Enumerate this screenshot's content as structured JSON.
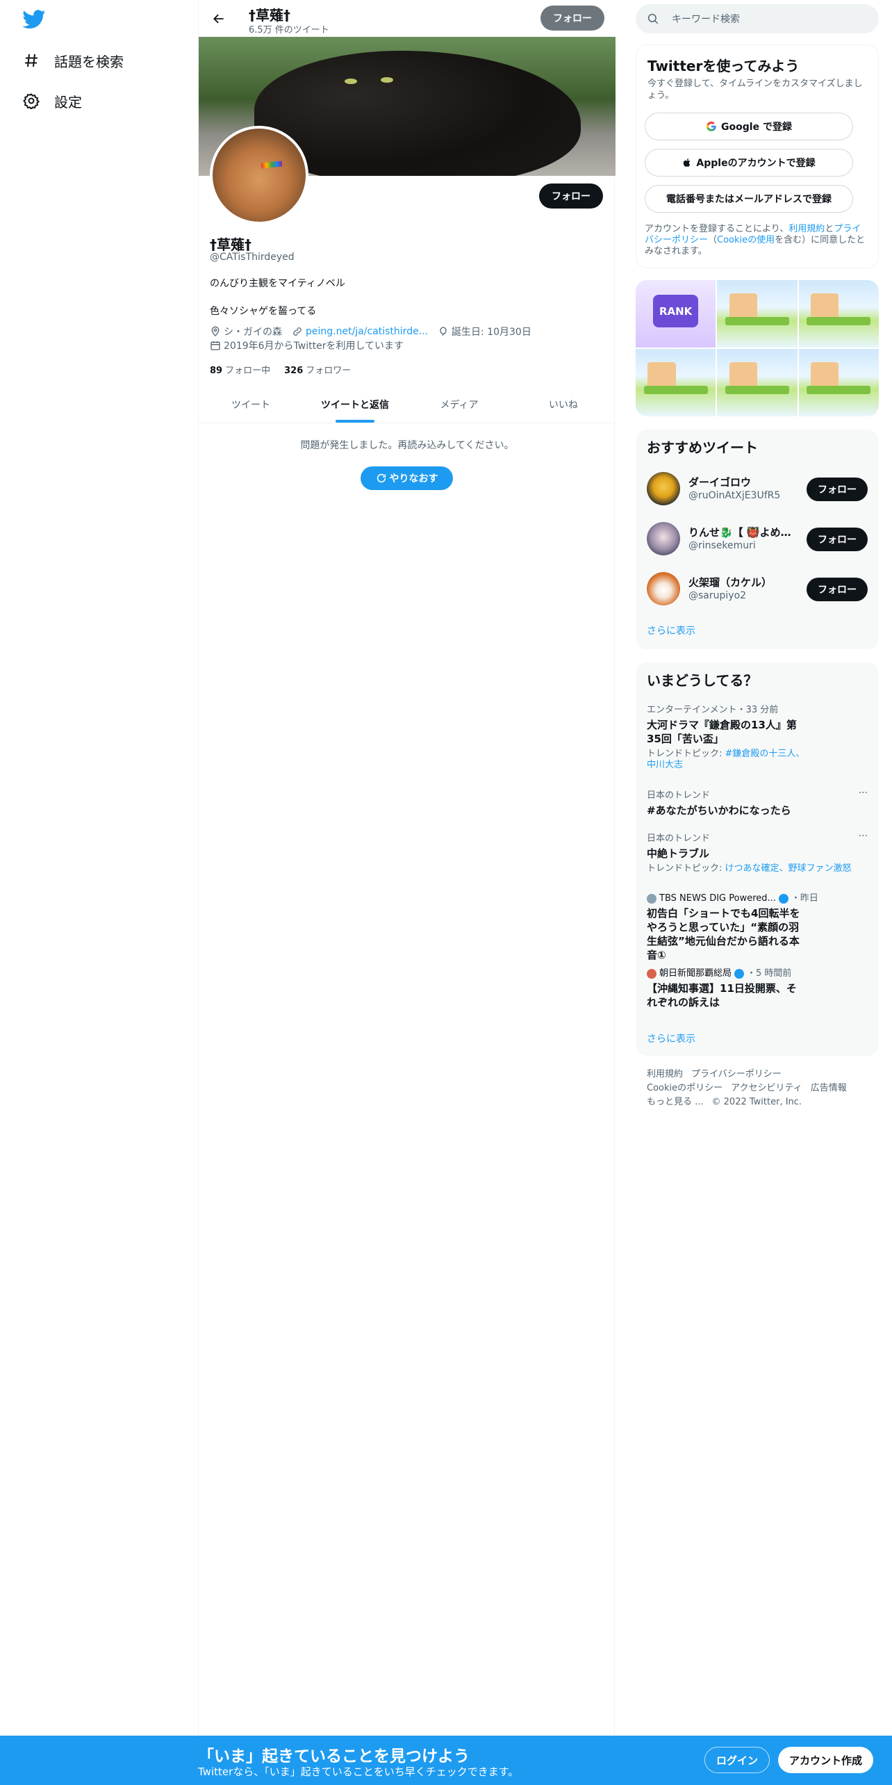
{
  "nav": {
    "explore_label": "話題を検索",
    "settings_label": "設定"
  },
  "header": {
    "name": "†草薙†",
    "tweet_count": "6.5万 件のツイート",
    "follow_label": "フォロー"
  },
  "profile": {
    "follow_label": "フォロー",
    "name": "†草薙†",
    "handle": "@CATisThirdeyed",
    "bio_line1": "のんびり主観をマイティノベル",
    "bio_line2": "色々ソシャゲを齧ってる",
    "location": "シ・ガイの森",
    "url": "peing.net/ja/catisthirde...",
    "birthday": "誕生日: 10月30日",
    "joined": "2019年6月からTwitterを利用しています",
    "following_count": "89",
    "following_label": "フォロー中",
    "followers_count": "326",
    "followers_label": "フォロワー"
  },
  "tabs": [
    "ツイート",
    "ツイートと返信",
    "メディア",
    "いいね"
  ],
  "active_tab": 1,
  "error": {
    "message": "問題が発生しました。再読み込みしてください。",
    "retry_label": "やりなおす"
  },
  "search": {
    "placeholder": "キーワード検索"
  },
  "signup": {
    "title": "Twitterを使ってみよう",
    "description": "今すぐ登録して、タイムラインをカスタマイズしましょう。",
    "google_label": "Google で登録",
    "apple_label": "Appleのアカウントで登録",
    "phone_label": "電話番号またはメールアドレスで登録",
    "legal_prefix": "アカウントを登録することにより、",
    "terms_link": "利用規約",
    "and": "と",
    "privacy_link": "プライバシーポリシー",
    "cookie_open": "（",
    "cookie_link": "Cookieの使用",
    "legal_suffix": "を含む）に同意したとみなされます。"
  },
  "media_thumb_text": "RANK",
  "recommend": {
    "title": "おすすめツイート",
    "users": [
      {
        "name": "ダーイゴロウ",
        "handle": "@ruOinAtXjE3UfR5",
        "follow": "フォロー"
      },
      {
        "name": "りんせ🐉【 👹よめ…",
        "handle": "@rinsekemuri",
        "follow": "フォロー"
      },
      {
        "name": "火架瑠（カケル）",
        "handle": "@sarupiyo2",
        "follow": "フォロー"
      }
    ],
    "more": "さらに表示"
  },
  "trends": {
    "title": "いまどうしてる？",
    "items": [
      {
        "context": "エンターテインメント・33 分前",
        "title": "大河ドラマ『鎌倉殿の13人』第35回「苦い盃」",
        "topic_prefix": "トレンドトピック: ",
        "topic": "#鎌倉殿の十三人、中川大志"
      },
      {
        "context": "日本のトレンド",
        "title": "#あなたがちいかわになったら",
        "dots": "···"
      },
      {
        "context": "日本のトレンド",
        "title": "中絶トラブル",
        "topic_prefix": "トレンドトピック: ",
        "topic": "けつあな確定、野球ファン激怒",
        "dots": "···"
      },
      {
        "source": "TBS NEWS DIG Powered...",
        "time": "・昨日",
        "title": "初告白「ショートでも4回転半をやろうと思っていた」“素顔の羽生結弦”地元仙台だから語れる本音①"
      },
      {
        "source": "朝日新聞那覇総局",
        "time": "・5 時間前",
        "title": "【沖縄知事選】11日投開票、それぞれの訴えは"
      }
    ],
    "more": "さらに表示"
  },
  "footer": {
    "links": [
      "利用規約",
      "プライバシーポリシー",
      "Cookieのポリシー",
      "アクセシビリティ",
      "広告情報",
      "もっと見る ...",
      "© 2022 Twitter, Inc."
    ]
  },
  "bottom_bar": {
    "title": "「いま」起きていることを見つけよう",
    "subtitle": "Twitterなら、「いま」起きていることをいち早くチェックできます。",
    "login_label": "ログイン",
    "signup_label": "アカウント作成"
  },
  "colors": {
    "accent": "#1d9bf0",
    "text": "#0f1419",
    "muted": "#536471"
  }
}
